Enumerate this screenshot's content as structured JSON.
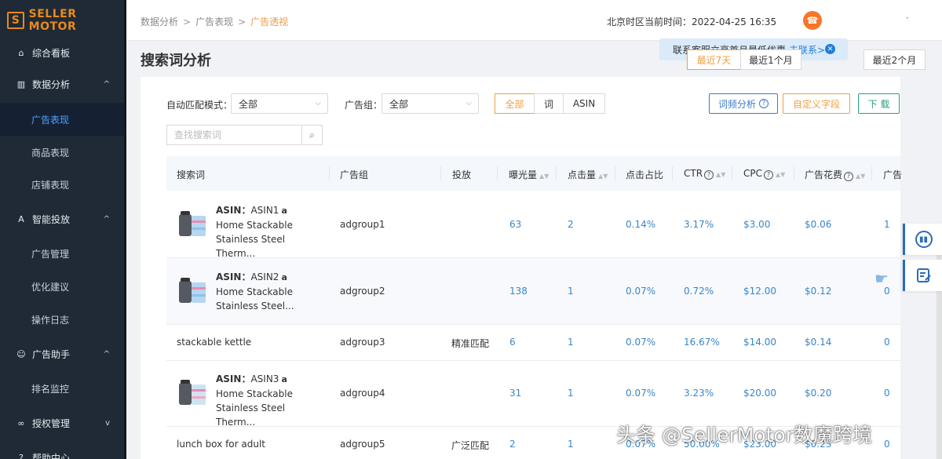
{
  "app": {
    "logo_mark": "S",
    "logo_text": "SELLER MOTOR"
  },
  "sidebar": {
    "items": [
      {
        "label": "综合看板",
        "icon": "home-icon",
        "type": "group"
      },
      {
        "label": "数据分析",
        "icon": "bar-chart-icon",
        "type": "group",
        "chevron": "^"
      },
      {
        "label": "广告表现",
        "type": "sub",
        "active": true
      },
      {
        "label": "商品表现",
        "type": "sub"
      },
      {
        "label": "店铺表现",
        "type": "sub"
      },
      {
        "label": "智能投放",
        "icon": "ad-icon",
        "type": "group",
        "chevron": "^"
      },
      {
        "label": "广告管理",
        "type": "sub"
      },
      {
        "label": "优化建议",
        "type": "sub"
      },
      {
        "label": "操作日志",
        "type": "sub"
      },
      {
        "label": "广告助手",
        "icon": "robot-icon",
        "type": "group",
        "chevron": "^"
      },
      {
        "label": "排名监控",
        "type": "sub"
      },
      {
        "label": "授权管理",
        "icon": "link-icon",
        "type": "group",
        "chevron": "v"
      },
      {
        "label": "帮助中心",
        "icon": "help-icon",
        "type": "group"
      }
    ]
  },
  "header": {
    "breadcrumb": [
      "数据分析",
      "广告表现",
      "广告透视"
    ],
    "time_label": "北京时区当前时间：",
    "time_value": "2022-04-25 16:35"
  },
  "tooltip": {
    "text": "联系客服立享首月最低优惠",
    "link": "去联系>"
  },
  "page_title": "搜索词分析",
  "date_ranges": [
    "最近7天",
    "最近1个月",
    "最近2个月"
  ],
  "filters": {
    "match_label": "自动匹配模式：",
    "match_value": "全部",
    "group_label": "广告组：",
    "group_value": "全部",
    "segments": [
      "全部",
      "词",
      "ASIN"
    ],
    "search_placeholder": "查找搜索词",
    "btn_word_freq": "词频分析",
    "btn_custom": "自定义字段",
    "btn_download": "下 载"
  },
  "table": {
    "columns": [
      "搜索词",
      "广告组",
      "投放",
      "曝光量",
      "点击量",
      "点击占比",
      "CTR",
      "CPC",
      "广告花费",
      "广告"
    ],
    "rows": [
      {
        "asin": true,
        "asin_label": "ASIN：",
        "asin_id": "ASIN1",
        "amz": "a",
        "title1": "Home Stackable",
        "title2": "Stainless Steel Therm...",
        "group": "adgroup1",
        "targeting": "",
        "impr": "63",
        "clicks": "2",
        "share": "0.14%",
        "ctr": "3.17%",
        "cpc": "$3.00",
        "spend": "$0.06",
        "ad": "1"
      },
      {
        "asin": true,
        "asin_label": "ASIN：",
        "asin_id": "ASIN2",
        "amz": "a",
        "title1": "Home Stackable",
        "title2": "Stainless Steel...",
        "group": "adgroup2",
        "targeting": "",
        "impr": "138",
        "clicks": "1",
        "share": "0.07%",
        "ctr": "0.72%",
        "cpc": "$12.00",
        "spend": "$0.12",
        "ad": "0"
      },
      {
        "asin": false,
        "term": "stackable kettle",
        "group": "adgroup3",
        "targeting": "精准匹配",
        "impr": "6",
        "clicks": "1",
        "share": "0.07%",
        "ctr": "16.67%",
        "cpc": "$14.00",
        "spend": "$0.14",
        "ad": "0"
      },
      {
        "asin": true,
        "asin_label": "ASIN：",
        "asin_id": "ASIN3",
        "amz": "a",
        "title1": "Home Stackable",
        "title2": "Stainless Steel Therm...",
        "group": "adgroup4",
        "targeting": "",
        "impr": "31",
        "clicks": "1",
        "share": "0.07%",
        "ctr": "3.23%",
        "cpc": "$20.00",
        "spend": "$0.20",
        "ad": "0"
      },
      {
        "asin": false,
        "term": "lunch box for adult",
        "group": "adgroup5",
        "targeting": "广泛匹配",
        "impr": "2",
        "clicks": "1",
        "share": "0.07%",
        "ctr": "50.00%",
        "cpc": "$23.00",
        "spend": "$0.23",
        "ad": "0"
      }
    ]
  },
  "watermark": "头条 @SellerMotor数魔跨境",
  "colors": {
    "sidebar_bg": "#1f2a36",
    "active_text": "#4aa3ff",
    "orange": "#f0a040",
    "link_blue": "#3a86c8",
    "logo": "#e8891b"
  }
}
